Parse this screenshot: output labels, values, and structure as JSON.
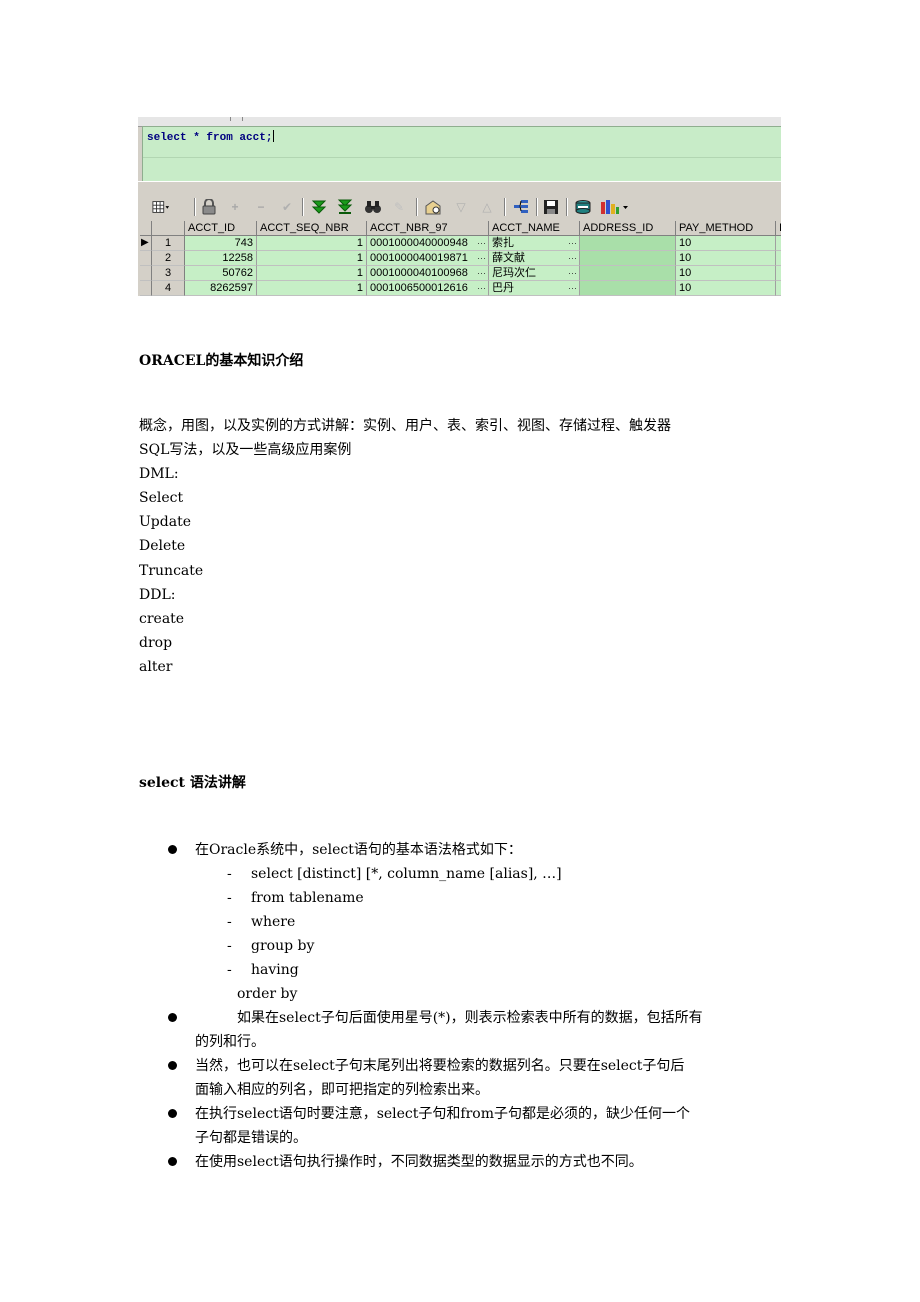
{
  "screenshot": {
    "editor_sql": "select * from acct;",
    "toolbar_icons": [
      "grid-view-dropdown-icon",
      "lock-icon",
      "add-record-icon",
      "delete-record-icon",
      "post-record-icon",
      "fetch-next-icon",
      "fetch-last-icon",
      "find-icon",
      "clear-icon",
      "query-by-example-icon",
      "sort-ascending-icon",
      "sort-descending-icon",
      "export-icon",
      "save-icon",
      "connection-icon",
      "chart-dropdown-icon"
    ],
    "grid": {
      "columns": [
        "ACCT_ID",
        "ACCT_SEQ_NBR",
        "ACCT_NBR_97",
        "ACCT_NAME",
        "ADDRESS_ID",
        "PAY_METHOD",
        "I"
      ],
      "rows": [
        {
          "num": "1",
          "acct_id": "743",
          "seq": "1",
          "nbr97": "0001000040000948",
          "name": "索扎",
          "address_id": "",
          "pay_method": "10"
        },
        {
          "num": "2",
          "acct_id": "12258",
          "seq": "1",
          "nbr97": "0001000040019871",
          "name": "薛文献",
          "address_id": "",
          "pay_method": "10"
        },
        {
          "num": "3",
          "acct_id": "50762",
          "seq": "1",
          "nbr97": "0001000040100968",
          "name": "尼玛次仁",
          "address_id": "",
          "pay_method": "10"
        },
        {
          "num": "4",
          "acct_id": "8262597",
          "seq": "1",
          "nbr97": "0001006500012616",
          "name": "巴丹",
          "address_id": "",
          "pay_method": "10"
        }
      ],
      "ellipsis": "···",
      "current_row_marker": "▶"
    }
  },
  "doc": {
    "heading1": "ORACEL的基本知识介绍",
    "intro_lines": [
      "概念，用图，以及实例的方式讲解：实例、用户、表、索引、视图、存储过程、触发器",
      "SQL写法，以及一些高级应用案例"
    ],
    "dml_label": "DML:",
    "dml_items": [
      "Select",
      "Update",
      "Delete",
      "Truncate"
    ],
    "ddl_label": "DDL:",
    "ddl_items": [
      "create",
      "drop",
      "alter"
    ],
    "heading2": "select 语法讲解",
    "bullet1": "在Oracle系统中，select语句的基本语法格式如下：",
    "syntax_items": [
      "select [distinct] [*, column_name [alias], …]",
      "from tablename",
      "where",
      "group by",
      "having"
    ],
    "syntax_dash": "-",
    "syntax_last": "order by",
    "bullet2_lines": [
      "如果在select子句后面使用星号(*)，则表示检索表中所有的数据，包括所有",
      "的列和行。"
    ],
    "bullet3_lines": [
      "当然，也可以在select子句末尾列出将要检索的数据列名。只要在select子句后",
      "面输入相应的列名，即可把指定的列检索出来。"
    ],
    "bullet4_lines": [
      "在执行select语句时要注意，select子句和from子句都是必须的，缺少任何一个",
      "子句都是错误的。"
    ],
    "bullet5_lines": [
      "在使用select语句执行操作时，不同数据类型的数据显示的方式也不同。"
    ]
  }
}
